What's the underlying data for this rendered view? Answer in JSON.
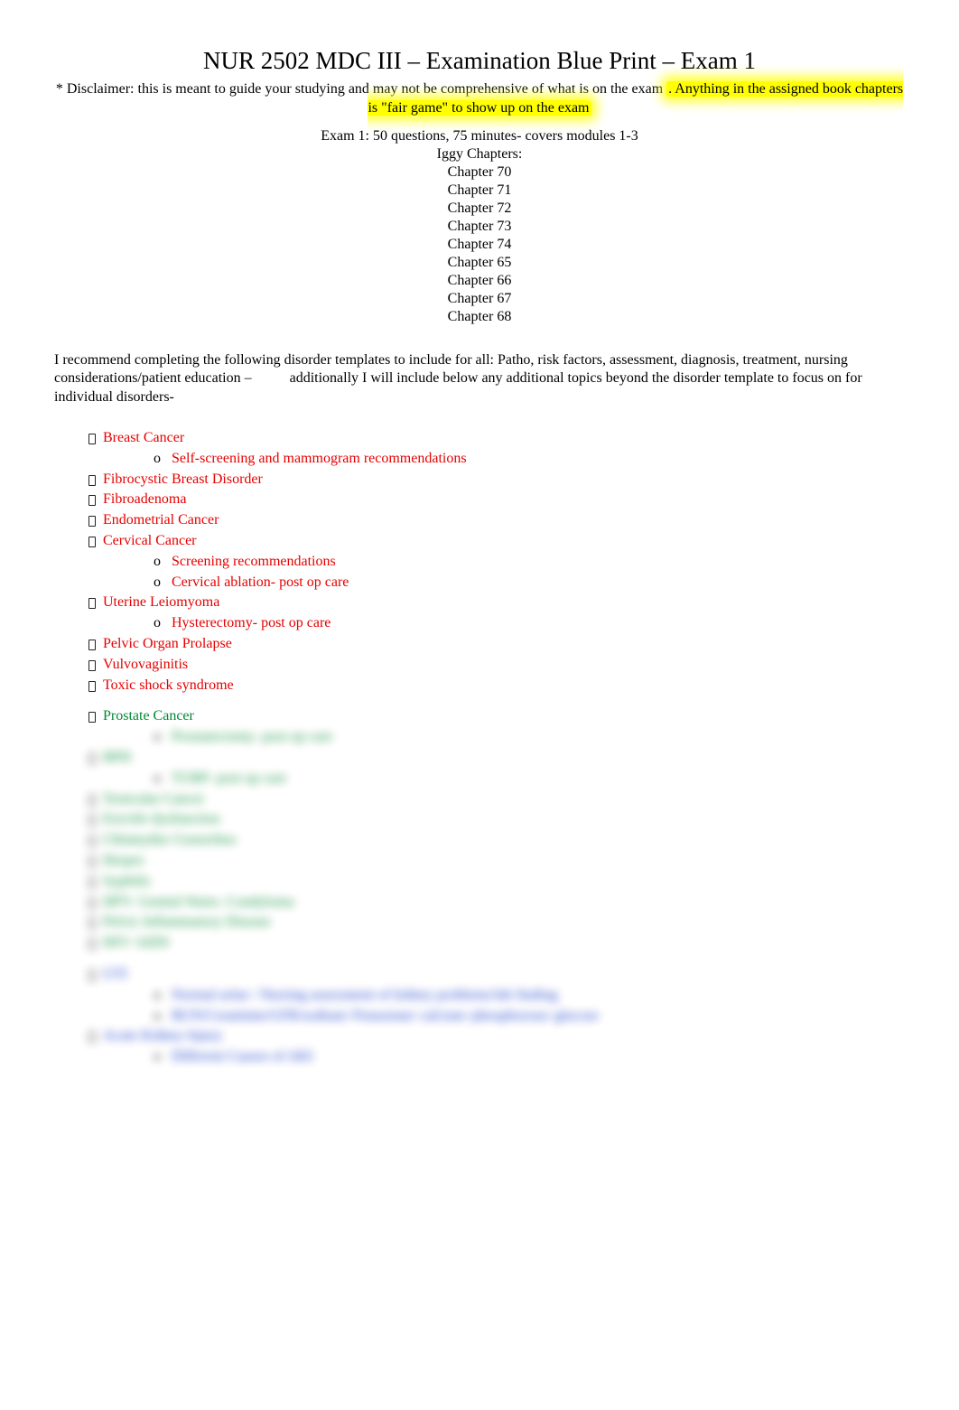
{
  "title": "NUR 2502 MDC III – Examination Blue Print – Exam 1",
  "disclaimer_pre": "* Disclaimer: this is meant to guide your studying and may not be comprehensive of what is on the exam",
  "disclaimer_hl": ". Anything in the assigned book chapters is \"fair game\" to show up on the exam",
  "exam_line": "Exam 1: 50 questions, 75 minutes- covers modules 1-3",
  "iggy_label": "Iggy Chapters:",
  "chapters": [
    "Chapter 70",
    "Chapter 71",
    "Chapter 72",
    "Chapter 73",
    "Chapter 74",
    "Chapter 65",
    "Chapter 66",
    "Chapter 67",
    "Chapter 68"
  ],
  "recommend_a": "I recommend completing the following disorder templates to include for all: Patho, risk factors, assessment, diagnosis, treatment, nursing considerations/patient education –",
  "recommend_b": "additionally I will include below any additional topics beyond the disorder template to focus on for individual disorders-",
  "red_items": {
    "breast": "Breast Cancer",
    "breast_sub": "Self-screening and mammogram recommendations",
    "fibro_breast": "Fibrocystic Breast Disorder",
    "fibroadenoma": "Fibroadenoma",
    "endometrial": "Endometrial Cancer",
    "cervical": "Cervical Cancer",
    "cervical_sub1": "Screening recommendations",
    "cervical_sub2": "Cervical ablation- post op care",
    "uterine": "Uterine Leiomyoma",
    "uterine_sub": "Hysterectomy- post op care",
    "pelvic": "Pelvic Organ Prolapse",
    "vulvo": "Vulvovaginitis",
    "toxic": "Toxic shock syndrome"
  },
  "green_items": {
    "prostate": "Prostate Cancer",
    "prostate_sub": "Prostatectomy- post op care",
    "bph": "BPH",
    "bph_sub": "TURP- post op care",
    "testicular": "Testicular Cancer",
    "erectile": "Erectile dysfunction",
    "chlamydia": "Chlamydia/ Gonorrhea",
    "herpes": "Herpes",
    "syphilis": "Syphilis",
    "genital_warts": "HPV- Genital Warts- Condyloma",
    "pid": "Pelvic Inflammatory Disease",
    "hiv": "HIV/ AIDS"
  },
  "blue_items": {
    "uti": "UTI",
    "uti_sub1": "Normal urine / Nursing assessment of kidney problems/lab finding",
    "uti_sub2": "BUN/Creatinine/GFR/sodium/ Potassium/ calcium /phosphorous/ glucose",
    "aki": "Acute Kidney Injury",
    "aki_sub": "Different Causes of AKI"
  }
}
